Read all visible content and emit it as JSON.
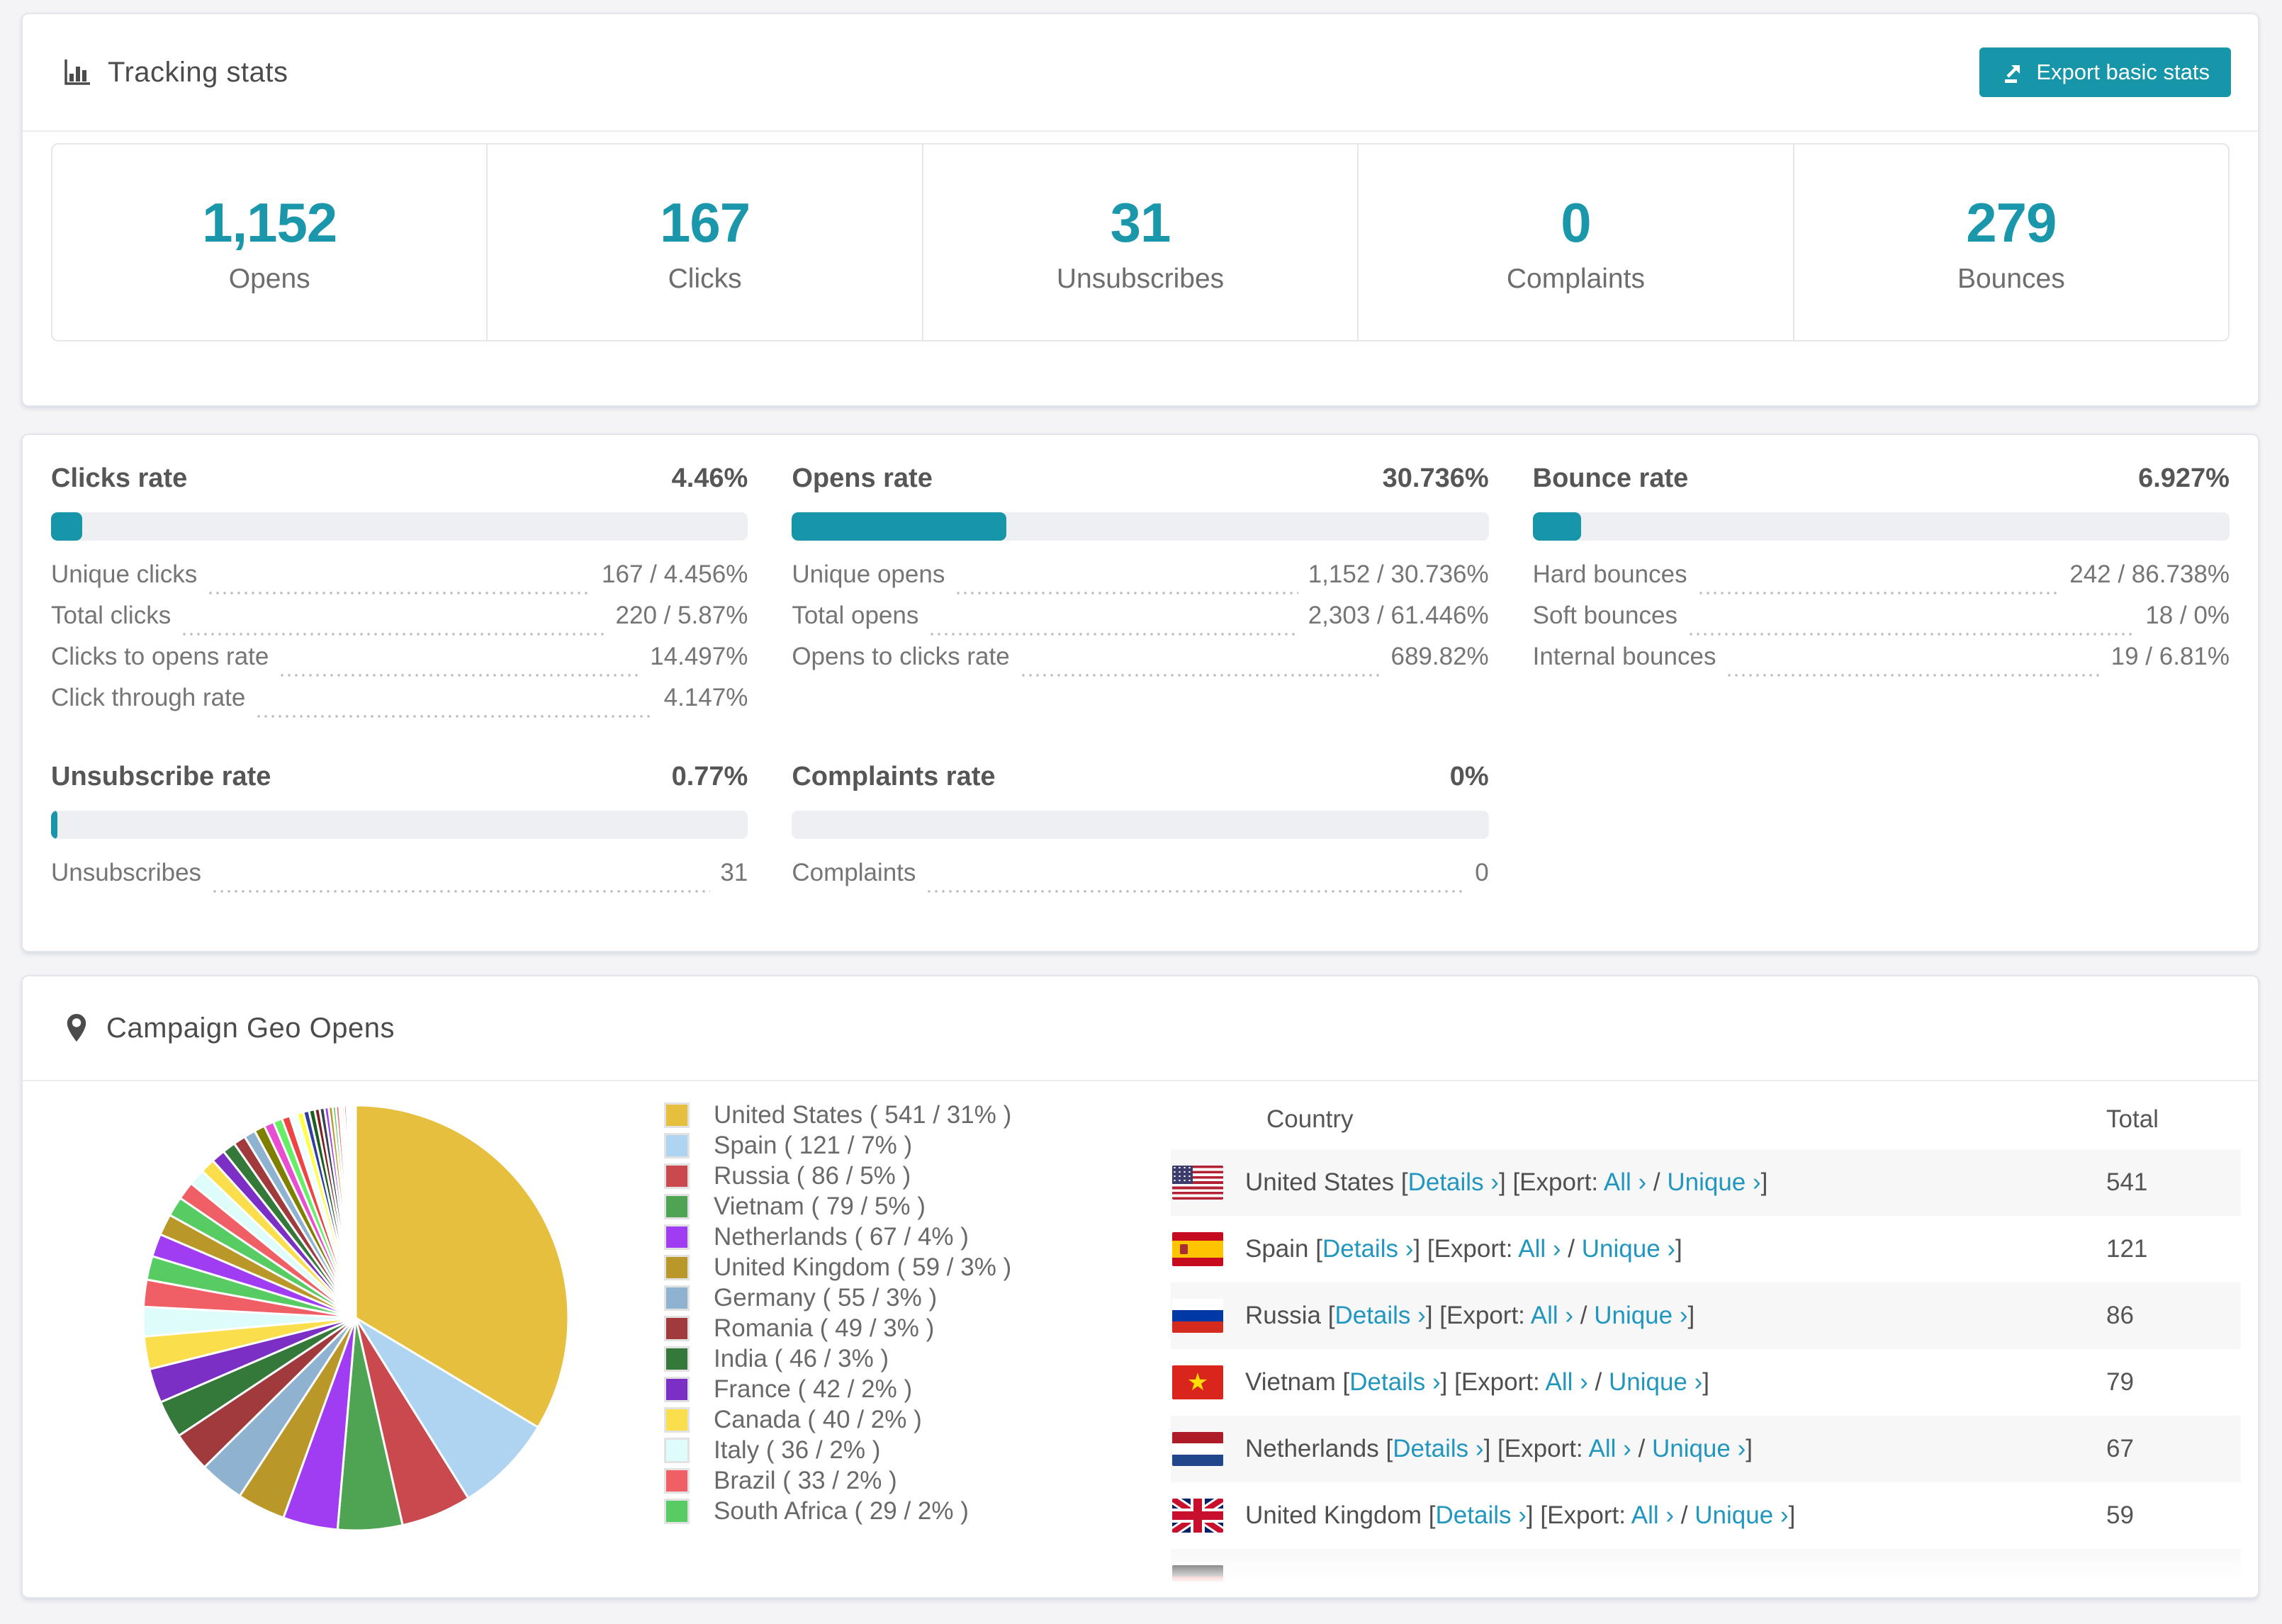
{
  "colors": {
    "accent_teal": "#1795a9",
    "stat_number_teal": "#1b97ab",
    "link_teal": "#2196be",
    "row_alt_gray": "#f7f7f8"
  },
  "tracking": {
    "title": "Tracking stats",
    "export_button_label": "Export basic stats",
    "summary": [
      {
        "value": "1,152",
        "label": "Opens"
      },
      {
        "value": "167",
        "label": "Clicks"
      },
      {
        "value": "31",
        "label": "Unsubscribes"
      },
      {
        "value": "0",
        "label": "Complaints"
      },
      {
        "value": "279",
        "label": "Bounces"
      }
    ]
  },
  "rates": [
    {
      "title": "Clicks rate",
      "value": "4.46%",
      "percent": 4.46,
      "rows": [
        {
          "label": "Unique clicks",
          "value": "167 / 4.456%"
        },
        {
          "label": "Total clicks",
          "value": "220 / 5.87%"
        },
        {
          "label": "Clicks to opens rate",
          "value": "14.497%"
        },
        {
          "label": "Click through rate",
          "value": "4.147%"
        }
      ]
    },
    {
      "title": "Opens rate",
      "value": "30.736%",
      "percent": 30.736,
      "rows": [
        {
          "label": "Unique opens",
          "value": "1,152 / 30.736%"
        },
        {
          "label": "Total opens",
          "value": "2,303 / 61.446%"
        },
        {
          "label": "Opens to clicks rate",
          "value": "689.82%"
        }
      ]
    },
    {
      "title": "Bounce rate",
      "value": "6.927%",
      "percent": 6.927,
      "rows": [
        {
          "label": "Hard bounces",
          "value": "242 / 86.738%"
        },
        {
          "label": "Soft bounces",
          "value": "18 / 0%"
        },
        {
          "label": "Internal bounces",
          "value": "19 / 6.81%"
        }
      ]
    },
    {
      "title": "Unsubscribe rate",
      "value": "0.77%",
      "percent": 0.77,
      "rows": [
        {
          "label": "Unsubscribes",
          "value": "31"
        }
      ]
    },
    {
      "title": "Complaints rate",
      "value": "0%",
      "percent": 0,
      "rows": [
        {
          "label": "Complaints",
          "value": "0"
        }
      ]
    }
  ],
  "geo": {
    "title": "Campaign Geo Opens",
    "chart_data": {
      "type": "pie",
      "title": "Campaign Geo Opens",
      "legend_position": "right",
      "series": [
        {
          "label": "United States",
          "value": 541,
          "pct": "31%",
          "color": "#e5bf3d"
        },
        {
          "label": "Spain",
          "value": 121,
          "pct": "7%",
          "color": "#aed4f2"
        },
        {
          "label": "Russia",
          "value": 86,
          "pct": "5%",
          "color": "#c9494e"
        },
        {
          "label": "Vietnam",
          "value": 79,
          "pct": "5%",
          "color": "#4ea452"
        },
        {
          "label": "Netherlands",
          "value": 67,
          "pct": "4%",
          "color": "#a03df2"
        },
        {
          "label": "United Kingdom",
          "value": 59,
          "pct": "3%",
          "color": "#ba9729"
        },
        {
          "label": "Germany",
          "value": 55,
          "pct": "3%",
          "color": "#8fb2d1"
        },
        {
          "label": "Romania",
          "value": 49,
          "pct": "3%",
          "color": "#a03a3d"
        },
        {
          "label": "India",
          "value": 46,
          "pct": "3%",
          "color": "#35793a"
        },
        {
          "label": "France",
          "value": 42,
          "pct": "2%",
          "color": "#7b2fc4"
        },
        {
          "label": "Canada",
          "value": 40,
          "pct": "2%",
          "color": "#fade4c"
        },
        {
          "label": "Italy",
          "value": 36,
          "pct": "2%",
          "color": "#defcf9"
        },
        {
          "label": "Brazil",
          "value": 33,
          "pct": "2%",
          "color": "#f05f66"
        },
        {
          "label": "South Africa",
          "value": 29,
          "pct": "2%",
          "color": "#57cc63"
        }
      ],
      "others": {
        "note": "unlabeled small slices, visually estimated",
        "values": [
          28,
          26,
          24,
          22,
          20,
          18,
          17,
          16,
          15,
          14,
          13,
          12,
          11,
          10,
          9,
          8,
          7,
          7,
          6,
          6,
          5,
          5,
          4,
          4,
          3,
          3,
          3,
          2,
          2,
          2,
          1,
          1,
          1,
          1,
          1
        ],
        "palette": [
          "#a03df2",
          "#ba9729",
          "#57cc63",
          "#f05f66",
          "#defcf9",
          "#fade4c",
          "#7b2fc4",
          "#35793a",
          "#a03a3d",
          "#8fb2d1",
          "#808000",
          "#e84fd0",
          "#66ee66",
          "#ee4444",
          "#f0ffff",
          "#ffff44",
          "#303f9f",
          "#1b5e20",
          "#7b1f1f",
          "#36454f"
        ]
      }
    },
    "legend_format": {
      "open": "(",
      "close": ")",
      "sep": "/"
    },
    "table": {
      "headers": [
        "Country",
        "Total"
      ],
      "link_labels": {
        "details": "Details ›",
        "export": "Export:",
        "all": "All ›",
        "unique": "Unique ›"
      },
      "row_format": {
        "lb": "[",
        "rb": "]",
        "slash": "/"
      },
      "rows": [
        {
          "flag": "us",
          "country": "United States",
          "total": "541"
        },
        {
          "flag": "es",
          "country": "Spain",
          "total": "121"
        },
        {
          "flag": "ru",
          "country": "Russia",
          "total": "86"
        },
        {
          "flag": "vn",
          "country": "Vietnam",
          "total": "79"
        },
        {
          "flag": "nl",
          "country": "Netherlands",
          "total": "67"
        },
        {
          "flag": "gb",
          "country": "United Kingdom",
          "total": "59"
        },
        {
          "flag": "de",
          "country": "",
          "total": "",
          "partial": true
        }
      ]
    }
  }
}
